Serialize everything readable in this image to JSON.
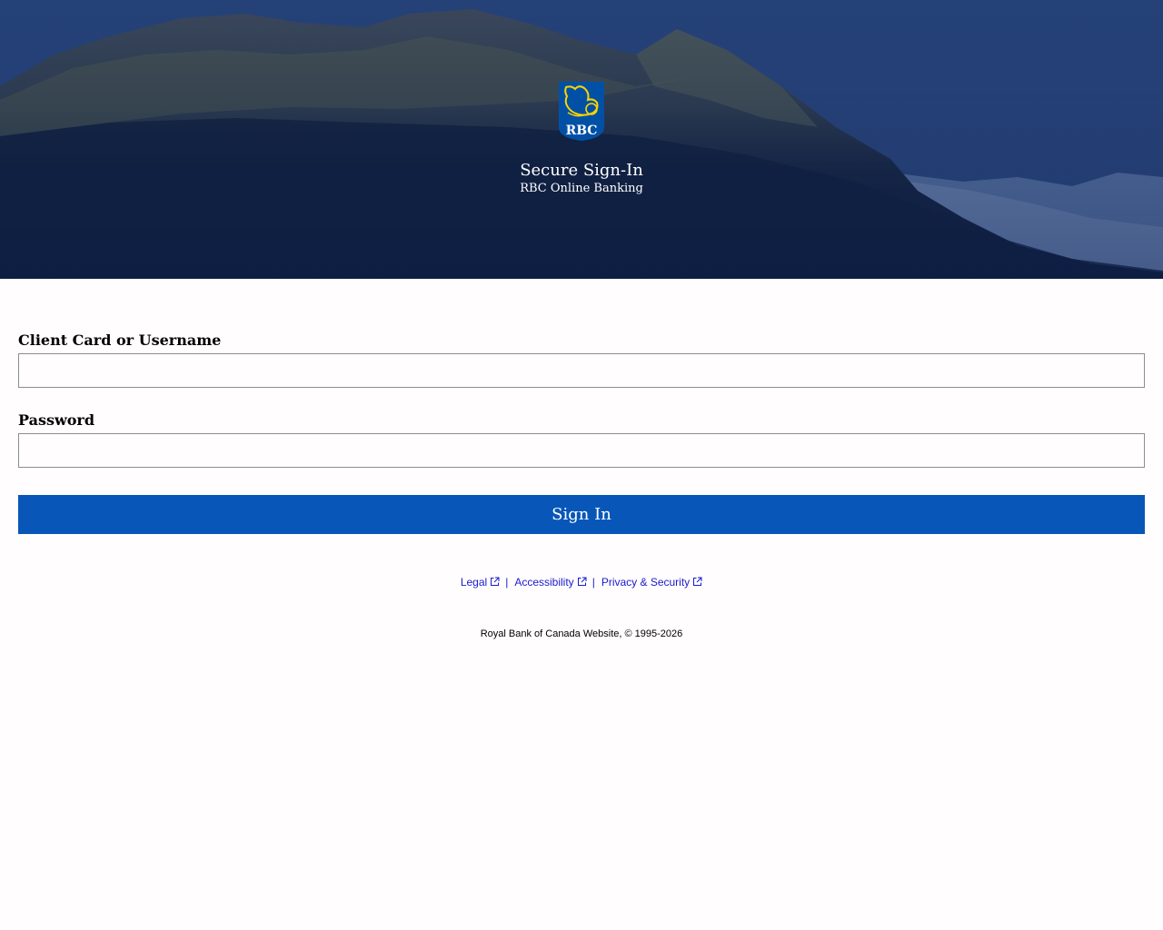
{
  "header": {
    "logo_text": "RBC",
    "title": "Secure Sign-In",
    "subtitle": "RBC Online Banking"
  },
  "form": {
    "username_label": "Client Card or Username",
    "username_value": "",
    "password_label": "Password",
    "password_value": "",
    "signin_label": "Sign In"
  },
  "footer": {
    "links": [
      {
        "label": "Legal",
        "icon": "external-link-icon"
      },
      {
        "label": "Accessibility",
        "icon": "external-link-icon"
      },
      {
        "label": "Privacy & Security",
        "icon": "external-link-icon"
      }
    ],
    "separator": "|",
    "copyright": "Royal Bank of Canada Website, © 1995-2026"
  },
  "colors": {
    "primary_button": "#0857b8",
    "link": "#1a1bcd",
    "logo_blue": "#0051a5",
    "logo_gold": "#ffd200"
  }
}
